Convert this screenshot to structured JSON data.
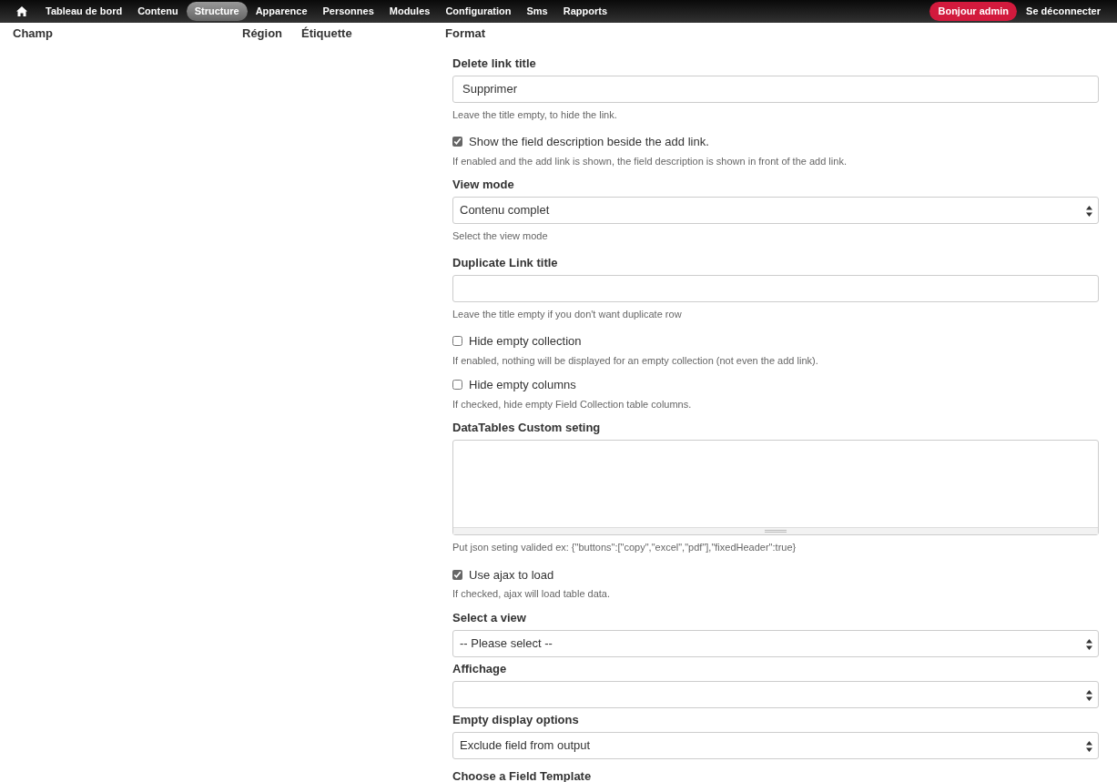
{
  "toolbar": {
    "menu": [
      {
        "label": "Tableau de bord",
        "selected": false
      },
      {
        "label": "Contenu",
        "selected": false
      },
      {
        "label": "Structure",
        "selected": true
      },
      {
        "label": "Apparence",
        "selected": false
      },
      {
        "label": "Personnes",
        "selected": false
      },
      {
        "label": "Modules",
        "selected": false
      },
      {
        "label": "Configuration",
        "selected": false
      },
      {
        "label": "Sms",
        "selected": false
      },
      {
        "label": "Rapports",
        "selected": false
      }
    ],
    "greeting": "Bonjour admin",
    "logout": "Se déconnecter"
  },
  "table": {
    "columns": [
      "Champ",
      "Région",
      "Étiquette",
      "Format"
    ]
  },
  "form": [
    {
      "kind": "text",
      "label": "Delete link title",
      "value": "Supprimer",
      "description": "Leave the title empty, to hide the link."
    },
    {
      "kind": "checkbox",
      "label": "Show the field description beside the add link.",
      "checked": true,
      "description": "If enabled and the add link is shown, the field description is shown in front of the add link."
    },
    {
      "kind": "select",
      "label": "View mode",
      "value": "Contenu complet",
      "description": "Select the view mode"
    },
    {
      "kind": "text",
      "label": "Duplicate Link title",
      "description": "Leave the title empty if you don't want duplicate row"
    },
    {
      "kind": "checkbox",
      "label": "Hide empty collection",
      "checked": false,
      "description": "If enabled, nothing will be displayed for an empty collection (not even the add link)."
    },
    {
      "kind": "checkbox",
      "label": "Hide empty columns",
      "checked": false,
      "description": "If checked, hide empty Field Collection table columns."
    },
    {
      "kind": "textarea",
      "label": "DataTables Custom seting",
      "description": "Put json seting valided ex: {\"buttons\":[\"copy\",\"excel\",\"pdf\"],\"fixedHeader\":true}"
    },
    {
      "kind": "checkbox",
      "label": "Use ajax to load",
      "checked": true,
      "description": "If checked, ajax will load table data."
    },
    {
      "kind": "select",
      "label": "Select a view",
      "value": "-- Please select --"
    },
    {
      "kind": "select",
      "label": "Affichage"
    },
    {
      "kind": "select",
      "label": "Empty display options",
      "value": "Exclude field from output"
    },
    {
      "kind": "heading",
      "label": "Choose a Field Template"
    }
  ]
}
